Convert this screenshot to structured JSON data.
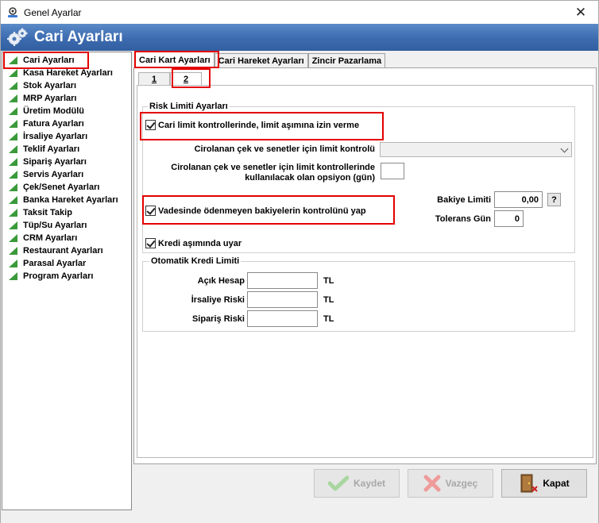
{
  "window": {
    "title": "Genel Ayarlar",
    "close_glyph": "✕"
  },
  "banner": {
    "title": "Cari Ayarları"
  },
  "sidebar": {
    "items": [
      {
        "label": "Cari Ayarları"
      },
      {
        "label": "Kasa Hareket Ayarları"
      },
      {
        "label": "Stok Ayarları"
      },
      {
        "label": "MRP Ayarları"
      },
      {
        "label": "Üretim Modülü"
      },
      {
        "label": "Fatura Ayarları"
      },
      {
        "label": "İrsaliye Ayarları"
      },
      {
        "label": "Teklif Ayarları"
      },
      {
        "label": "Sipariş Ayarları"
      },
      {
        "label": "Servis Ayarları"
      },
      {
        "label": "Çek/Senet Ayarları"
      },
      {
        "label": "Banka Hareket Ayarları"
      },
      {
        "label": "Taksit Takip"
      },
      {
        "label": "Tüp/Su Ayarları"
      },
      {
        "label": "CRM Ayarları"
      },
      {
        "label": "Restaurant Ayarları"
      },
      {
        "label": "Parasal Ayarlar"
      },
      {
        "label": "Program Ayarları"
      }
    ]
  },
  "tabs": [
    {
      "label": "Cari Kart Ayarları"
    },
    {
      "label": "Cari Hareket Ayarları"
    },
    {
      "label": "Zincir Pazarlama"
    }
  ],
  "subtabs": [
    {
      "label": "1"
    },
    {
      "label": "2"
    }
  ],
  "risk": {
    "group_title": "Risk Limiti Ayarları",
    "allow_overlimit": "Cari limit kontrollerinde, limit aşımına izin verme",
    "endorsed_label": "Cirolanan çek ve senetler için limit kontrolü",
    "endorsed_value": "",
    "option_days_label_1": "Cirolanan çek ve senetler için limit kontrollerinde",
    "option_days_label_2": "kullanılacak olan opsiyon (gün)",
    "option_days_value": "",
    "overdue_check": "Vadesinde ödenmeyen bakiyelerin kontrolünü yap",
    "balance_limit_label": "Bakiye Limiti",
    "balance_limit_value": "0,00",
    "help_button": "?",
    "tolerance_label": "Tolerans Gün",
    "tolerance_value": "0",
    "credit_warn": "Kredi aşımında uyar"
  },
  "auto_credit": {
    "group_title": "Otomatik Kredi Limiti",
    "rows": [
      {
        "label": "Açık Hesap",
        "value": "",
        "unit": "TL"
      },
      {
        "label": "İrsaliye Riski",
        "value": "",
        "unit": "TL"
      },
      {
        "label": "Sipariş Riski",
        "value": "",
        "unit": "TL"
      }
    ]
  },
  "buttons": {
    "save": "Kaydet",
    "cancel": "Vazgeç",
    "close": "Kapat"
  },
  "colors": {
    "banner": "#3c6bb0",
    "highlight": "#e30000",
    "tree_icon": "#3a9a3a"
  }
}
